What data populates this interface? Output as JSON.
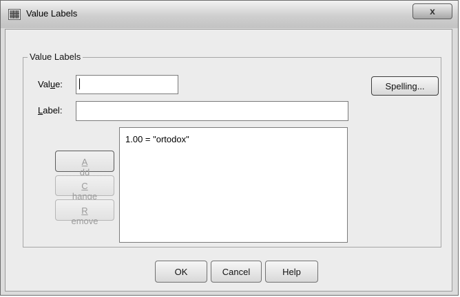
{
  "window": {
    "title": "Value Labels",
    "close_label": "x"
  },
  "group": {
    "legend": "Value Labels"
  },
  "form": {
    "value_label_pre": "Val",
    "value_label_u": "u",
    "value_label_post": "e:",
    "value_input": "",
    "label_label_u": "L",
    "label_label_post": "abel:",
    "label_input": ""
  },
  "buttons": {
    "spelling": "Spelling...",
    "add_u": "A",
    "add_rest": "dd",
    "change_u": "C",
    "change_rest": "hange",
    "remove_u": "R",
    "remove_rest": "emove",
    "ok": "OK",
    "cancel": "Cancel",
    "help": "Help"
  },
  "list": {
    "items": [
      "1.00 = \"ortodox\""
    ]
  }
}
